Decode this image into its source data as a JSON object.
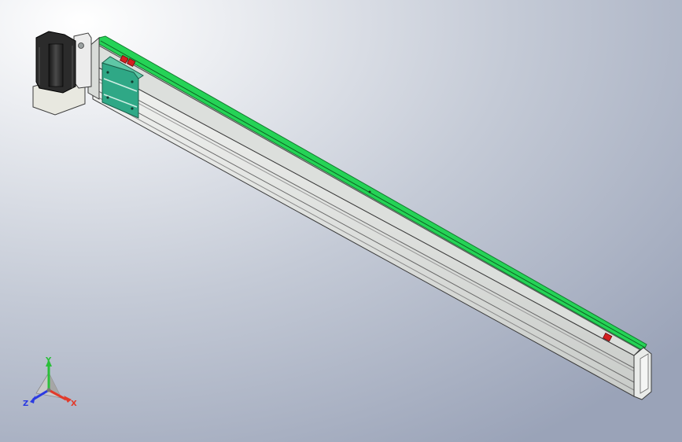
{
  "viewport": {
    "background_top": "#ffffff",
    "background_bottom": "#9aa3b8",
    "colors": {
      "rail": "#25d356",
      "profile": "#e6e8e6",
      "carriage": "#2fa886",
      "motor": "#2b2b2b",
      "stop_marker": "#d42020"
    }
  },
  "triad": {
    "x_label": "X",
    "y_label": "Y",
    "z_label": "Z",
    "x_color": "#e23a2a",
    "y_color": "#2bbf3a",
    "z_color": "#2a3ae2"
  }
}
